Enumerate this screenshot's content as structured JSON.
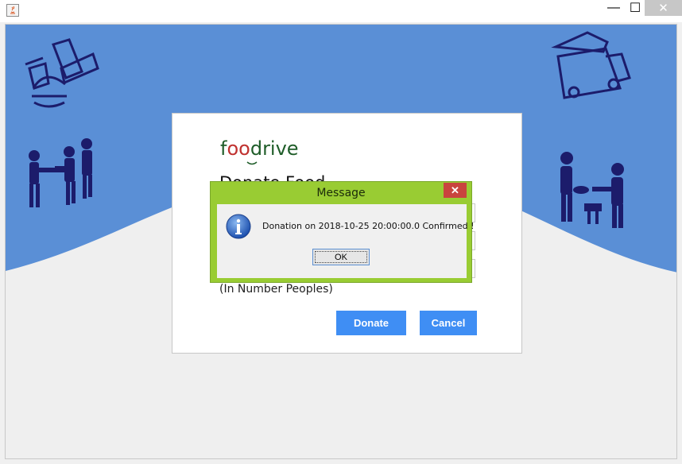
{
  "window": {
    "app_icon": "java-cup-icon",
    "minimize_glyph": "—",
    "maximize_glyph": "☐",
    "close_glyph": "✕"
  },
  "theme": {
    "banner_color": "#5a8fd6",
    "icon_color": "#1c1c6b",
    "button_color": "#3f8ef4",
    "dialog_frame_color": "#99cc33"
  },
  "logo": {
    "prefix": "f",
    "accent": "oo",
    "suffix": "drive"
  },
  "form": {
    "heading": "Donate Food",
    "hint": "(In Number Peoples)",
    "donate_label": "Donate",
    "cancel_label": "Cancel"
  },
  "dialog": {
    "title": "Message",
    "close_glyph": "✕",
    "message": "Donation on 2018-10-25 20:00:00.0 Confirmed !",
    "ok_label": "OK",
    "icon": "information-icon"
  }
}
